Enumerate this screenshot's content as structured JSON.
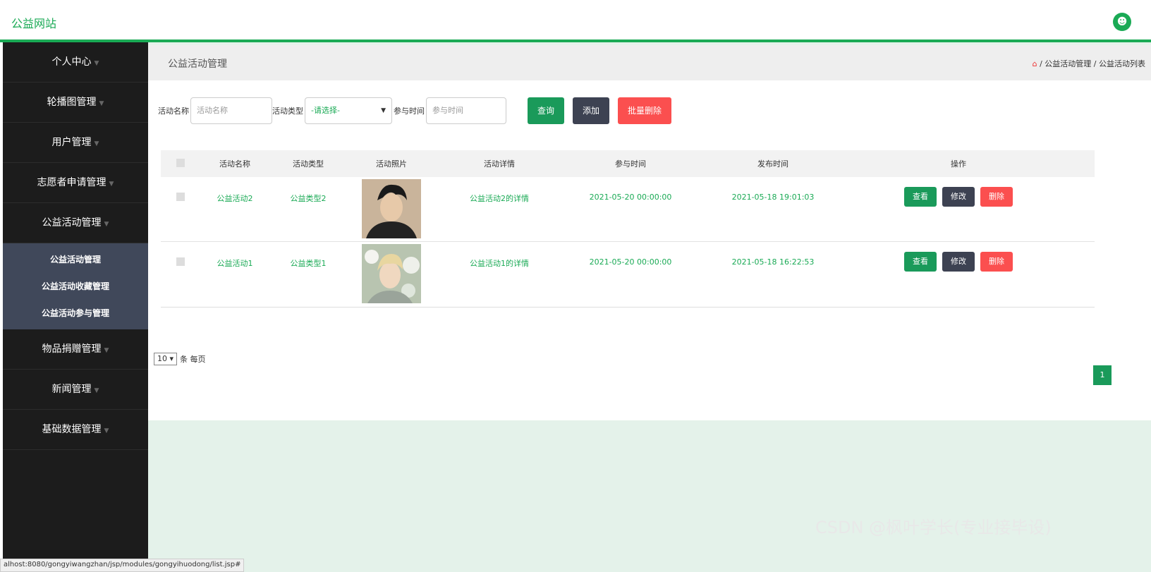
{
  "header": {
    "site_title": "公益网站",
    "user_icon": "user-icon"
  },
  "sidebar": {
    "items": [
      {
        "label": "个人中心"
      },
      {
        "label": "轮播图管理"
      },
      {
        "label": "用户管理"
      },
      {
        "label": "志愿者申请管理"
      },
      {
        "label": "公益活动管理"
      }
    ],
    "submenu": [
      {
        "label": "公益活动管理"
      },
      {
        "label": "公益活动收藏管理"
      },
      {
        "label": "公益活动参与管理"
      }
    ],
    "items_after": [
      {
        "label": "物品捐赠管理"
      },
      {
        "label": "新闻管理"
      },
      {
        "label": "基础数据管理"
      }
    ]
  },
  "page": {
    "title": "公益活动管理",
    "breadcrumb": {
      "part1": "公益活动管理",
      "part2": "公益活动列表",
      "sep": "/"
    }
  },
  "search": {
    "name_label": "活动名称",
    "name_placeholder": "活动名称",
    "type_label": "活动类型",
    "type_selected": "-请选择-",
    "time_label": "参与时间",
    "time_placeholder": "参与时间",
    "query_btn": "查询",
    "add_btn": "添加",
    "batch_delete_btn": "批量删除"
  },
  "table": {
    "headers": [
      "活动名称",
      "活动类型",
      "活动照片",
      "活动详情",
      "参与时间",
      "发布时间",
      "操作"
    ],
    "rows": [
      {
        "name": "公益活动2",
        "type": "公益类型2",
        "detail": "公益活动2的详情",
        "join_time": "2021-05-20 00:00:00",
        "publish_time": "2021-05-18 19:01:03"
      },
      {
        "name": "公益活动1",
        "type": "公益类型1",
        "detail": "公益活动1的详情",
        "join_time": "2021-05-20 00:00:00",
        "publish_time": "2021-05-18 16:22:53"
      }
    ],
    "view_btn": "查看",
    "edit_btn": "修改",
    "delete_btn": "删除"
  },
  "pagination": {
    "page_size": "10",
    "per_page_label": "条 每页",
    "current_page": "1"
  },
  "statusbar": {
    "url": "alhost:8080/gongyiwangzhan/jsp/modules/gongyihuodong/list.jsp#"
  },
  "watermark": "CSDN @枫叶学长(专业接毕设)",
  "colors": {
    "accent": "#1aaa55",
    "sidebar": "#1c1c1c",
    "submenu": "#40485a",
    "danger": "#fb4f4f"
  }
}
